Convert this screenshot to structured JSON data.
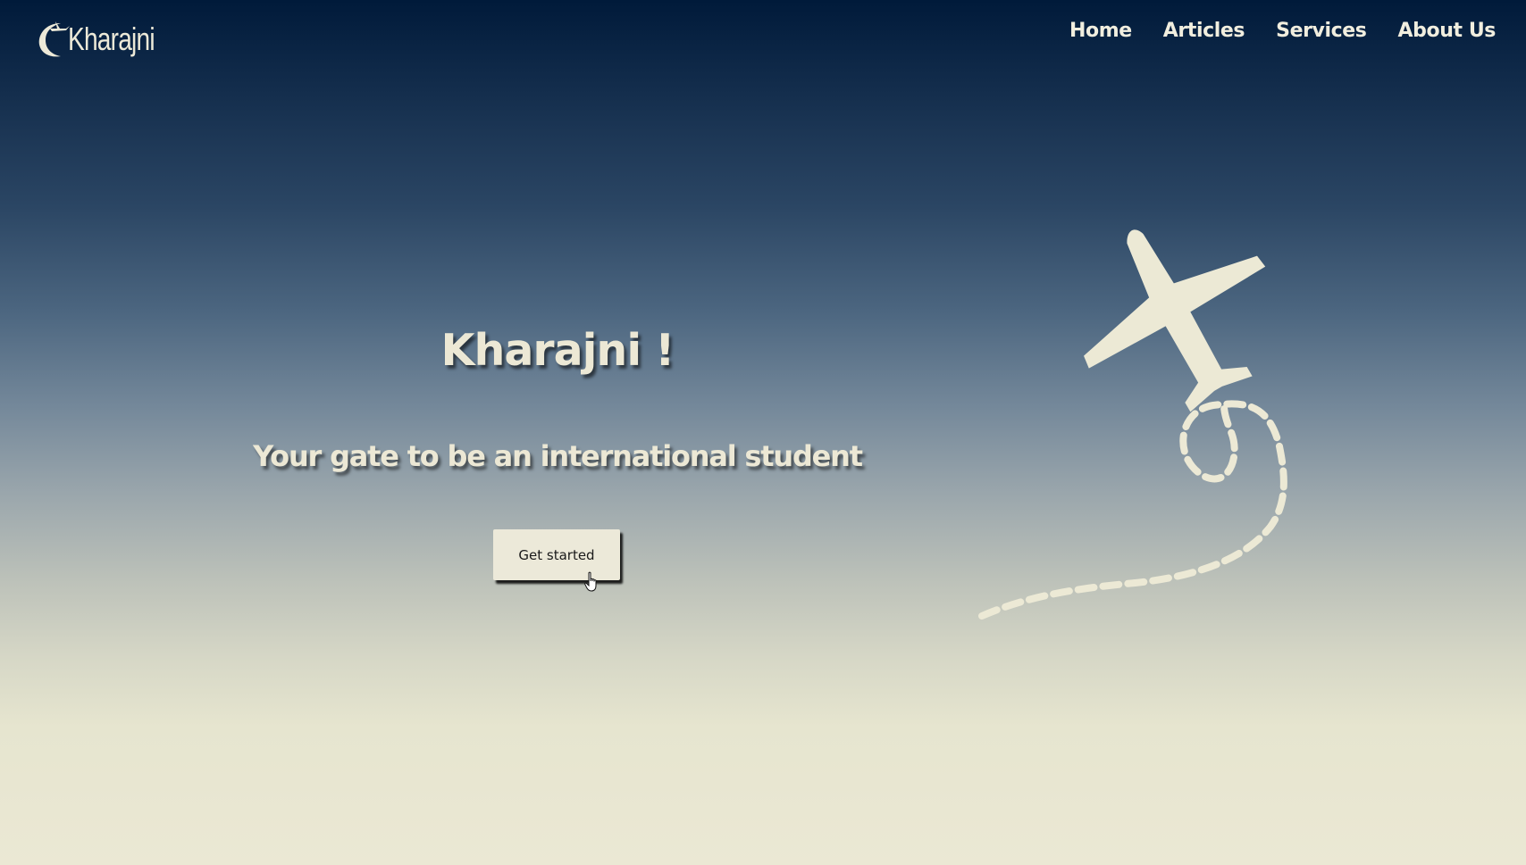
{
  "brand": {
    "name": "Kharajni"
  },
  "nav": {
    "items": [
      {
        "label": "Home"
      },
      {
        "label": "Articles"
      },
      {
        "label": "Services"
      },
      {
        "label": "About Us"
      }
    ]
  },
  "hero": {
    "title": "Kharajni !",
    "subtitle": "Your gate to be an international student",
    "cta_label": "Get started"
  },
  "icons": {
    "logo": "crescent-plane-icon",
    "illustration": "airplane-icon",
    "cursor": "hand-pointer-icon"
  },
  "colors": {
    "sky_top": "#001a3a",
    "sky_bottom": "#ebe8d4",
    "accent_cream": "#ece9d8"
  }
}
